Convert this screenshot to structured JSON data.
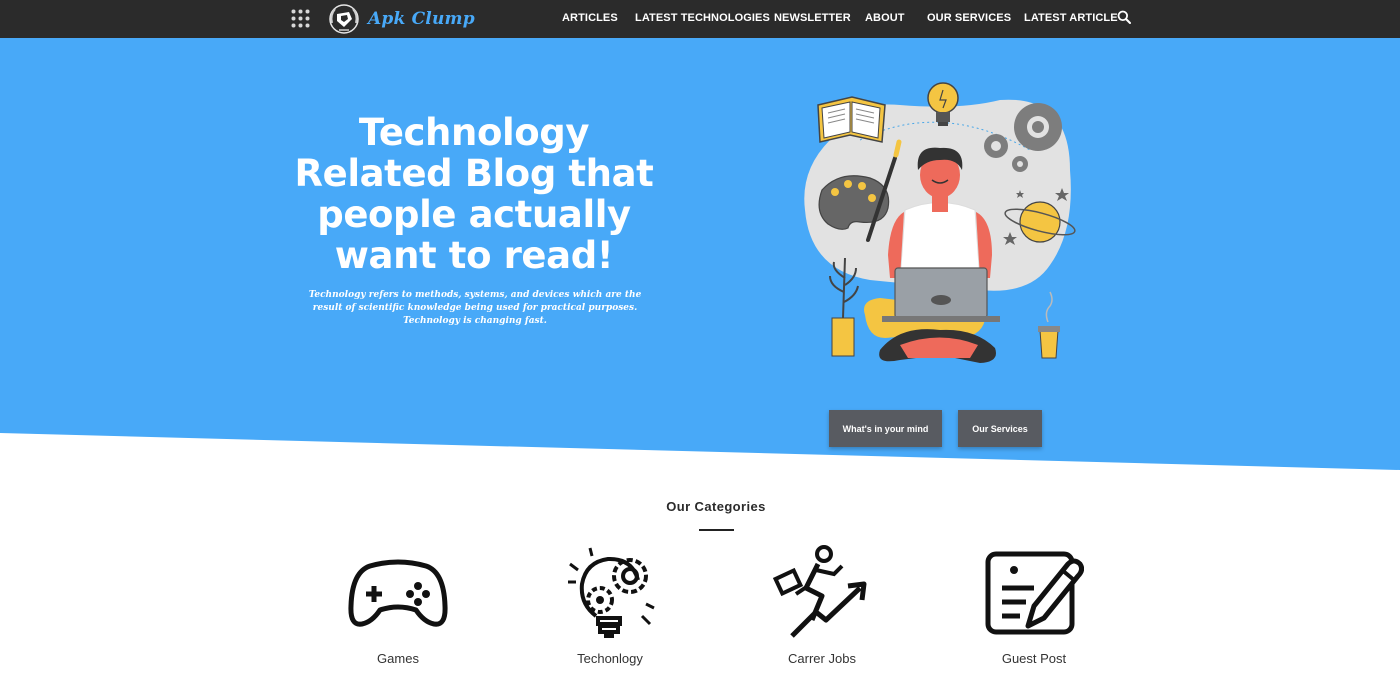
{
  "header": {
    "logo_text": "Apk Clump",
    "nav": [
      {
        "label": "ARTICLES"
      },
      {
        "label": "LATEST TECHNOLOGIES"
      },
      {
        "label": "NEWSLETTER"
      },
      {
        "label": "ABOUT"
      },
      {
        "label": "OUR SERVICES"
      },
      {
        "label": "LATEST ARTICLE"
      }
    ],
    "icons": {
      "menu": "apps-grid-icon",
      "search": "search-icon"
    }
  },
  "hero": {
    "title": "Technology Related Blog that people actually want to read!",
    "description": "Technology refers to methods, systems, and devices which are the result of scientific knowledge being used for practical purposes. Technology is changing fast.",
    "buttons": {
      "mind": "What's in your mind",
      "services": "Our Services"
    }
  },
  "categories": {
    "heading": "Our Categories",
    "items": [
      {
        "label": "Games",
        "icon": "gamepad-icon"
      },
      {
        "label": "Techonlogy",
        "icon": "lightbulb-gears-icon"
      },
      {
        "label": "Carrer Jobs",
        "icon": "career-growth-icon"
      },
      {
        "label": "Guest Post",
        "icon": "edit-document-icon"
      }
    ]
  },
  "colors": {
    "header_bg": "#2b2b2b",
    "hero_bg": "#48a9f8",
    "brand": "#48a9f8",
    "button_bg": "#585b61"
  }
}
